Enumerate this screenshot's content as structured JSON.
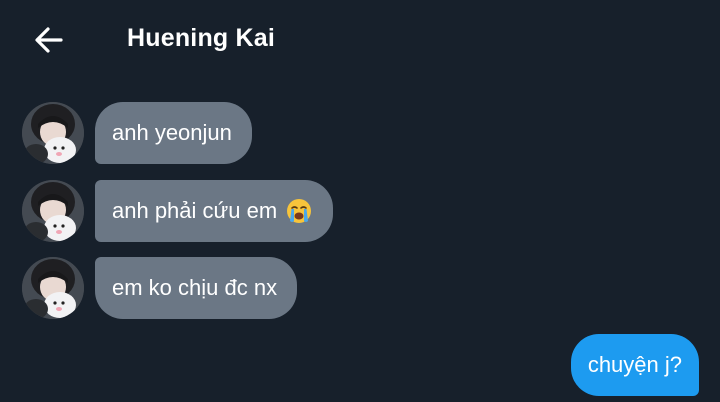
{
  "header": {
    "title": "Huening Kai",
    "back_icon": "arrow-left-icon"
  },
  "messages": [
    {
      "direction": "incoming",
      "text": "anh yeonjun"
    },
    {
      "direction": "incoming",
      "text": "anh phải cứu em",
      "emoji": "loudly-crying-face-icon"
    },
    {
      "direction": "incoming",
      "text": "em ko chịu đc nx"
    },
    {
      "direction": "outgoing",
      "text": "chuyện j?"
    }
  ],
  "colors": {
    "background": "#17202b",
    "incoming_bubble": "#6b7785",
    "outgoing_bubble": "#1d9bf0",
    "text": "#ffffff"
  }
}
